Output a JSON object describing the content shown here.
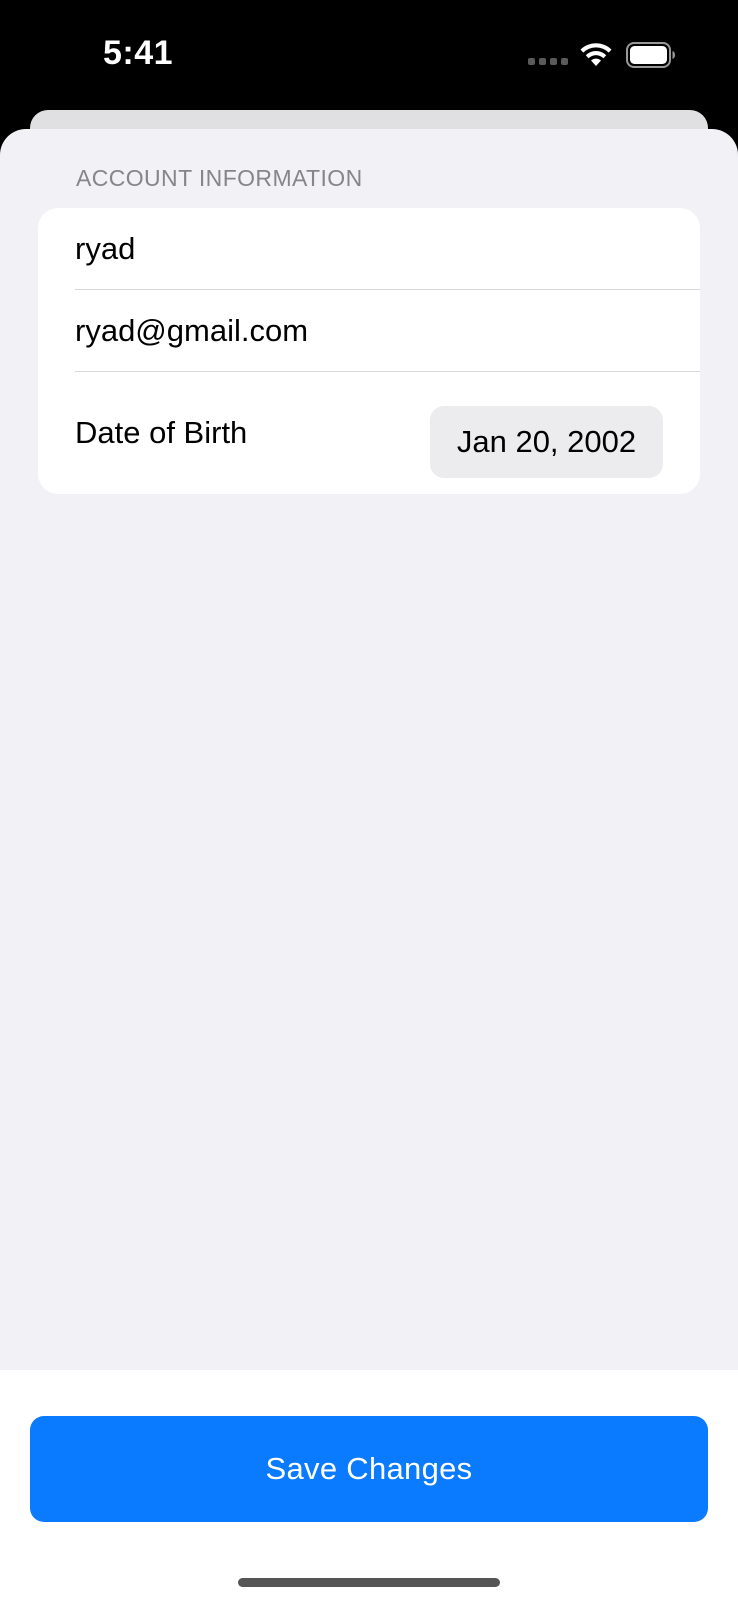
{
  "status_bar": {
    "time": "5:41",
    "icons": [
      "cellular-signal-icon",
      "wifi-icon",
      "battery-icon"
    ]
  },
  "form": {
    "section_header": "ACCOUNT INFORMATION",
    "username_value": "ryad",
    "email_value": "ryad@gmail.com",
    "dob_label": "Date of Birth",
    "dob_value": "Jan 20, 2002"
  },
  "actions": {
    "save_label": "Save Changes"
  },
  "colors": {
    "accent": "#0a7aff",
    "background": "#f1f1f6",
    "card": "#ffffff",
    "section_header_text": "#85858b"
  }
}
